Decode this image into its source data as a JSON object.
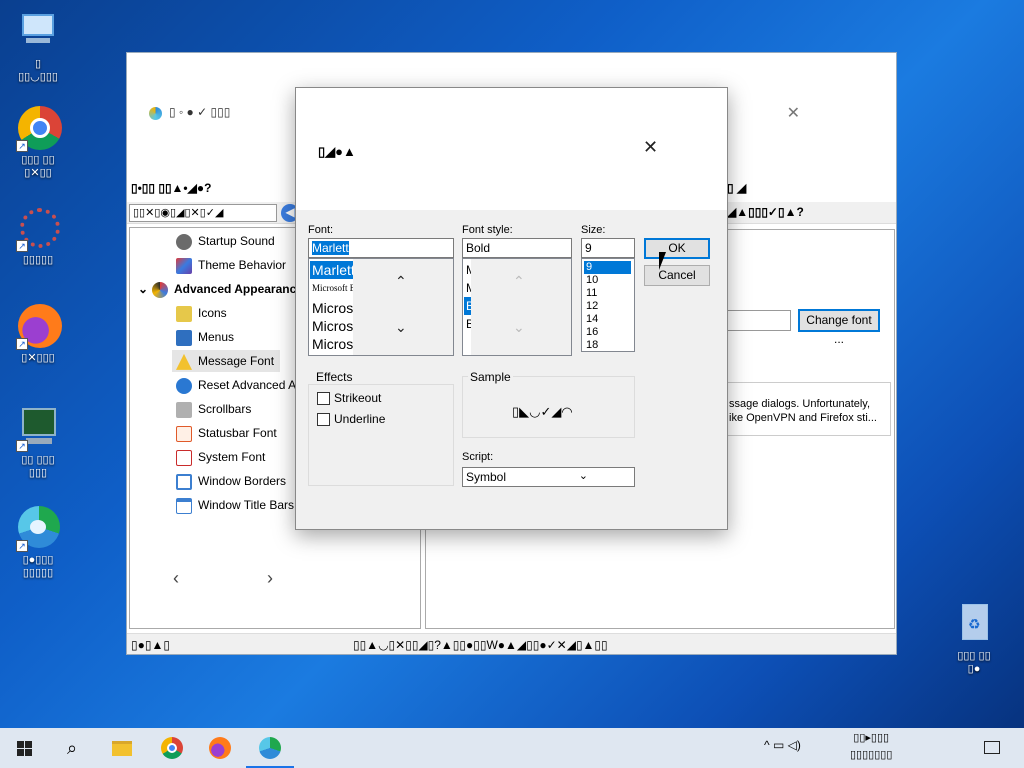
{
  "desktop": {
    "icons": [
      {
        "name": "this-pc",
        "label": "▯\n▯▯◡▯▯▯"
      },
      {
        "name": "chrome",
        "label": "▯▯▯ ▯▯\n▯✕▯▯"
      },
      {
        "name": "settings",
        "label": "▯▯▯▯▯"
      },
      {
        "name": "firefox",
        "label": "▯✕▯▯▯"
      },
      {
        "name": "task-manager",
        "label": "▯▯ ▯▯▯\n▯▯▯"
      },
      {
        "name": "edge",
        "label": "▯●▯▯▯\n▯▯▯▯▯"
      },
      {
        "name": "recycle-bin",
        "label": "▯▯▯ ▯▯\n▯●"
      }
    ]
  },
  "app": {
    "title": "▯ ◦ ● ✓ ▯▯▯",
    "menu_left": "▯•▯▯  ▯▯▲•◢●?",
    "menu_right": "▯ ◢",
    "address": "▯▯✕▯◉▯◢▯✕▯✓◢",
    "toolbar_right": "◢▲▯▯▯✓▯▲?",
    "tree": {
      "items": [
        {
          "label": "Startup Sound",
          "color": "#6b6b6b"
        },
        {
          "label": "Theme Behavior",
          "color": "#6a3fa8"
        },
        {
          "label": "Advanced Appearance",
          "color": "#2a2a2a"
        },
        {
          "label": "Icons",
          "color": "#e6c84a"
        },
        {
          "label": "Menus",
          "color": "#2f6fbf"
        },
        {
          "label": "Message Font",
          "color": "#f2c12e"
        },
        {
          "label": "Reset Advanced App",
          "color": "#2a78d2"
        },
        {
          "label": "Scrollbars",
          "color": "#b0b0b0"
        },
        {
          "label": "Statusbar Font",
          "color": "#e05a2a"
        },
        {
          "label": "System Font",
          "color": "#c92b2b"
        },
        {
          "label": "Window Borders",
          "color": "#3c7fd0"
        },
        {
          "label": "Window Title Bars",
          "color": "#3c7fd0"
        }
      ],
      "selected": "Message Font",
      "nav_prev": "‹",
      "nav_next": "›"
    },
    "change_font_button": "Change font ...",
    "description_line1": "ssage dialogs. Unfortunately,",
    "description_line2": "ike OpenVPN and Firefox sti...",
    "status_left": "▯●▯▲▯",
    "status_right": "▯▯▲◡▯✕▯▯◢▯?▲▯▯●▯▯W●▲◢▯▯●✓✕◢▯▲▯▯"
  },
  "font_dialog": {
    "title": "▯◢●▲",
    "close": "✕",
    "font_label": "Font:",
    "font_value": "Marlett",
    "font_list": [
      "Marlett",
      "Microsoft E",
      "",
      "Micros",
      "Micros",
      "Micros"
    ],
    "style_label": "Font style:",
    "style_value": "Bold",
    "style_list": [
      "M",
      "M",
      "B",
      "B"
    ],
    "size_label": "Size:",
    "size_value": "9",
    "size_list": [
      "9",
      "10",
      "11",
      "12",
      "14",
      "16",
      "18"
    ],
    "ok": "OK",
    "cancel": "Cancel",
    "effects_label": "Effects",
    "strikeout": "Strikeout",
    "underline": "Underline",
    "sample_label": "Sample",
    "sample_text": "▯◣◡✓◢◠",
    "script_label": "Script:",
    "script_value": "Symbol"
  },
  "taskbar": {
    "icons": [
      "start",
      "search",
      "file-explorer",
      "chrome",
      "firefox",
      "edge"
    ],
    "tray": "^ ▭ ◁)",
    "clock_line1": "▯▯▸▯▯▯",
    "clock_line2": "▯▯▯▯▯▯▯"
  }
}
